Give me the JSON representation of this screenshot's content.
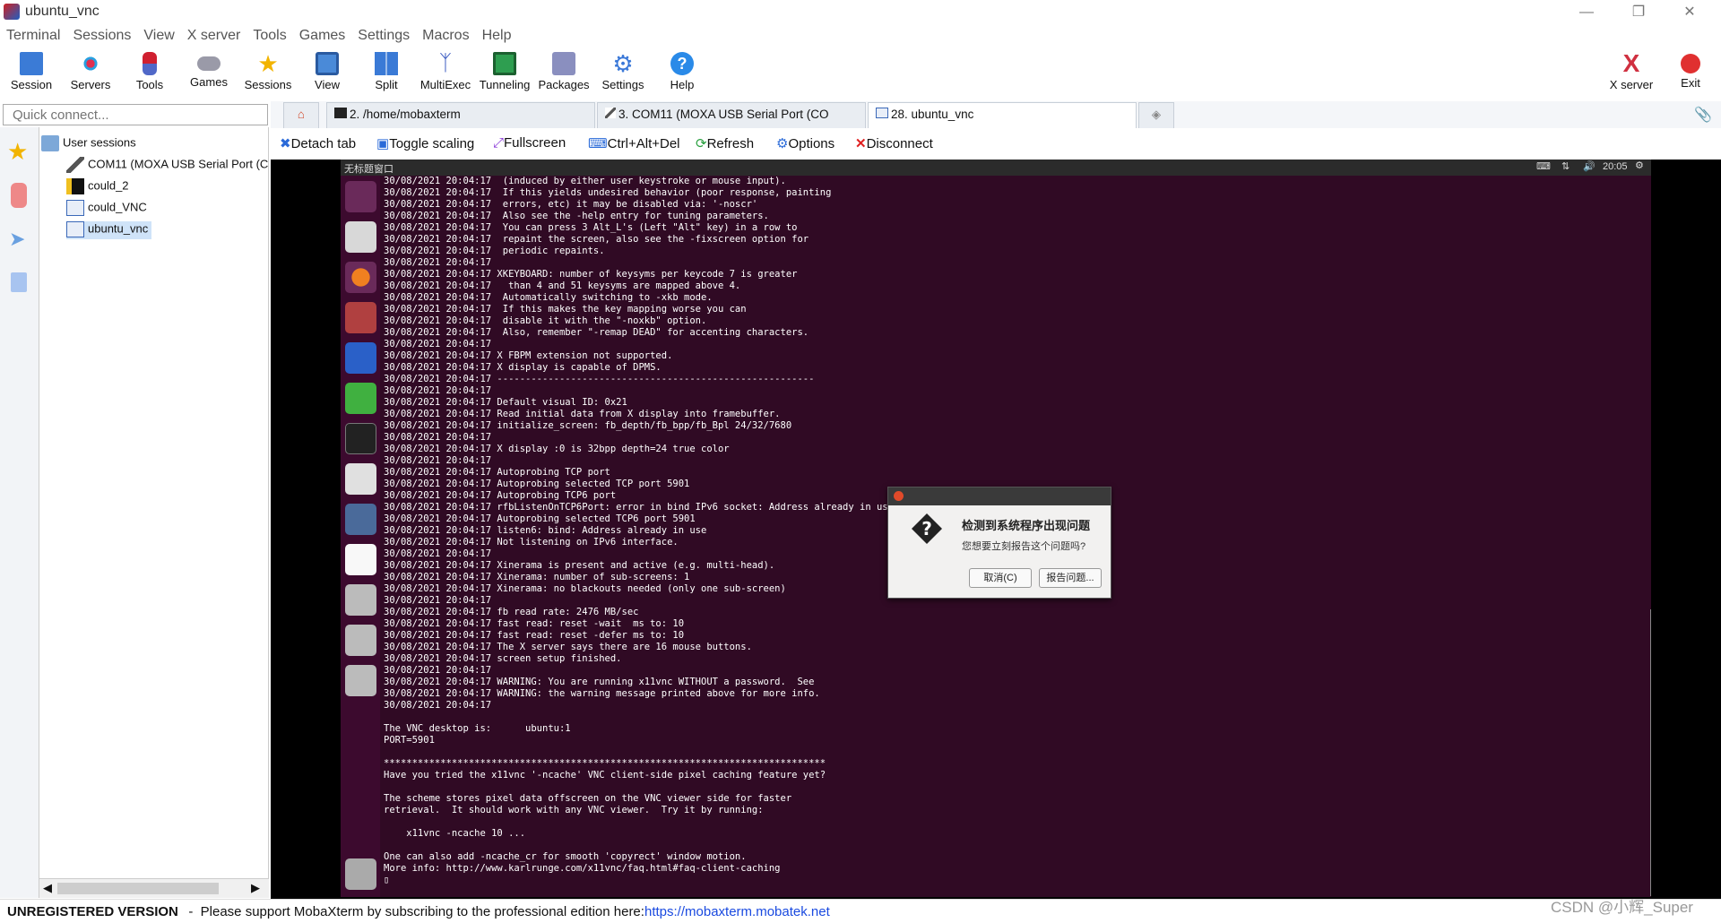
{
  "window": {
    "title": "ubuntu_vnc"
  },
  "menu": [
    "Terminal",
    "Sessions",
    "View",
    "X server",
    "Tools",
    "Games",
    "Settings",
    "Macros",
    "Help"
  ],
  "toolbar": {
    "items": [
      "Session",
      "Servers",
      "Tools",
      "Games",
      "Sessions",
      "View",
      "Split",
      "MultiExec",
      "Tunneling",
      "Packages",
      "Settings",
      "Help"
    ],
    "xserver": "X server",
    "exit": "Exit"
  },
  "quick_connect": {
    "placeholder": "Quick connect..."
  },
  "sessions": {
    "root": "User sessions",
    "items": [
      "COM11  (MOXA USB Serial Port (C",
      "could_2",
      "could_VNC",
      "ubuntu_vnc"
    ]
  },
  "tabs": [
    "2. /home/mobaxterm",
    "3. COM11  (MOXA USB Serial Port (CO",
    "28. ubuntu_vnc"
  ],
  "actions": [
    "Detach tab",
    "Toggle scaling",
    "Fullscreen",
    "Ctrl+Alt+Del",
    "Refresh",
    "Options",
    "Disconnect"
  ],
  "remote": {
    "window_title": "无标题窗口",
    "clock": "20:05",
    "terminal_lines": [
      "30/08/2021 20:04:17  (induced by either user keystroke or mouse input).",
      "30/08/2021 20:04:17  If this yields undesired behavior (poor response, painting",
      "30/08/2021 20:04:17  errors, etc) it may be disabled via: '-noscr'",
      "30/08/2021 20:04:17  Also see the -help entry for tuning parameters.",
      "30/08/2021 20:04:17  You can press 3 Alt_L's (Left \"Alt\" key) in a row to",
      "30/08/2021 20:04:17  repaint the screen, also see the -fixscreen option for",
      "30/08/2021 20:04:17  periodic repaints.",
      "30/08/2021 20:04:17",
      "30/08/2021 20:04:17 XKEYBOARD: number of keysyms per keycode 7 is greater",
      "30/08/2021 20:04:17   than 4 and 51 keysyms are mapped above 4.",
      "30/08/2021 20:04:17  Automatically switching to -xkb mode.",
      "30/08/2021 20:04:17  If this makes the key mapping worse you can",
      "30/08/2021 20:04:17  disable it with the \"-noxkb\" option.",
      "30/08/2021 20:04:17  Also, remember \"-remap DEAD\" for accenting characters.",
      "30/08/2021 20:04:17",
      "30/08/2021 20:04:17 X FBPM extension not supported.",
      "30/08/2021 20:04:17 X display is capable of DPMS.",
      "30/08/2021 20:04:17 --------------------------------------------------------",
      "30/08/2021 20:04:17",
      "30/08/2021 20:04:17 Default visual ID: 0x21",
      "30/08/2021 20:04:17 Read initial data from X display into framebuffer.",
      "30/08/2021 20:04:17 initialize_screen: fb_depth/fb_bpp/fb_Bpl 24/32/7680",
      "30/08/2021 20:04:17",
      "30/08/2021 20:04:17 X display :0 is 32bpp depth=24 true color",
      "30/08/2021 20:04:17",
      "30/08/2021 20:04:17 Autoprobing TCP port",
      "30/08/2021 20:04:17 Autoprobing selected TCP port 5901",
      "30/08/2021 20:04:17 Autoprobing TCP6 port",
      "30/08/2021 20:04:17 rfbListenOnTCP6Port: error in bind IPv6 socket: Address already in use",
      "30/08/2021 20:04:17 Autoprobing selected TCP6 port 5901",
      "30/08/2021 20:04:17 listen6: bind: Address already in use",
      "30/08/2021 20:04:17 Not listening on IPv6 interface.",
      "30/08/2021 20:04:17",
      "30/08/2021 20:04:17 Xinerama is present and active (e.g. multi-head).",
      "30/08/2021 20:04:17 Xinerama: number of sub-screens: 1",
      "30/08/2021 20:04:17 Xinerama: no blackouts needed (only one sub-screen)",
      "30/08/2021 20:04:17",
      "30/08/2021 20:04:17 fb read rate: 2476 MB/sec",
      "30/08/2021 20:04:17 fast read: reset -wait  ms to: 10",
      "30/08/2021 20:04:17 fast read: reset -defer ms to: 10",
      "30/08/2021 20:04:17 The X server says there are 16 mouse buttons.",
      "30/08/2021 20:04:17 screen setup finished.",
      "30/08/2021 20:04:17",
      "30/08/2021 20:04:17 WARNING: You are running x11vnc WITHOUT a password.  See",
      "30/08/2021 20:04:17 WARNING: the warning message printed above for more info.",
      "30/08/2021 20:04:17",
      "",
      "The VNC desktop is:      ubuntu:1",
      "PORT=5901",
      "",
      "******************************************************************************",
      "Have you tried the x11vnc '-ncache' VNC client-side pixel caching feature yet?",
      "",
      "The scheme stores pixel data offscreen on the VNC viewer side for faster",
      "retrieval.  It should work with any VNC viewer.  Try it by running:",
      "",
      "    x11vnc -ncache 10 ...",
      "",
      "One can also add -ncache_cr for smooth 'copyrect' window motion.",
      "More info: http://www.karlrunge.com/x11vnc/faq.html#faq-client-caching",
      "▯"
    ]
  },
  "dialog": {
    "title": "检测到系统程序出现问题",
    "message": "您想要立刻报告这个问题吗?",
    "cancel": "取消(C)",
    "report": "报告问题..."
  },
  "status": {
    "unregistered": "UNREGISTERED VERSION",
    "support_text": "  -  Please support MobaXterm by subscribing to the professional edition here:  ",
    "link": "https://mobaxterm.mobatek.net",
    "watermark": "CSDN @小辉_Super"
  }
}
